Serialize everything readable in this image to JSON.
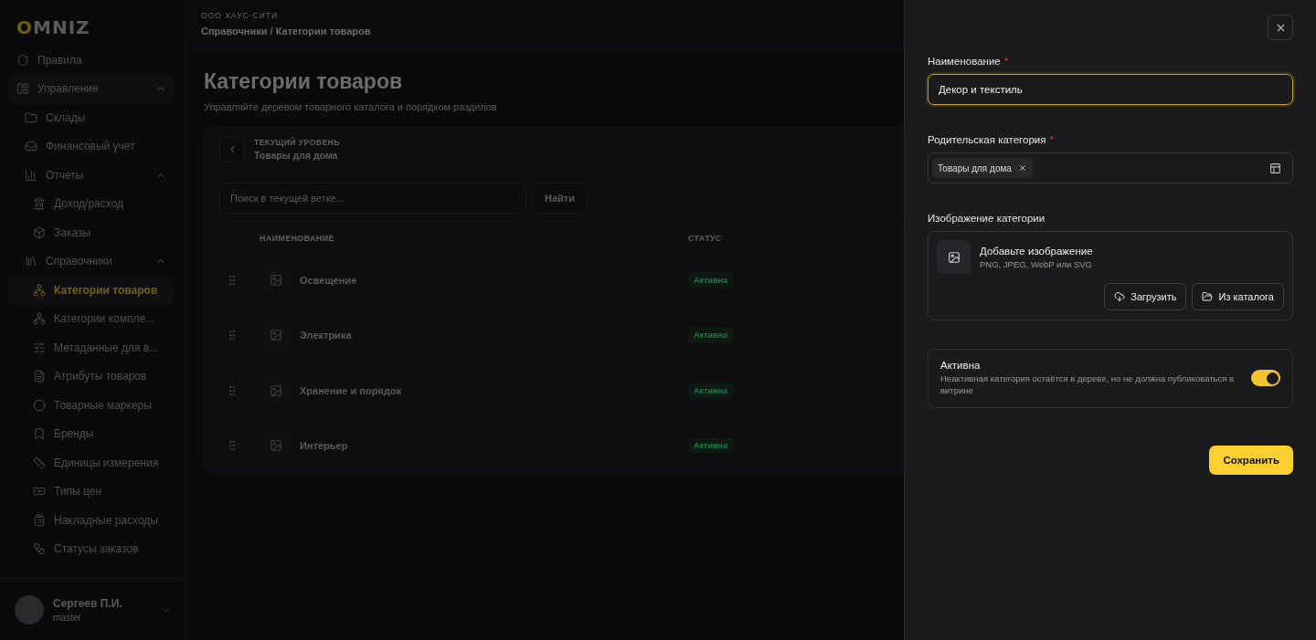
{
  "sidebar": {
    "logo": {
      "accent": "O",
      "rest": "MNIZ"
    },
    "items": [
      {
        "label": "Правила",
        "selected": false
      },
      {
        "label": "Управление",
        "selected": false,
        "expanded": true,
        "children": [
          {
            "label": "Склады",
            "selected": false
          },
          {
            "label": "Финансовый учет",
            "selected": false
          },
          {
            "label": "Отчеты",
            "selected": false,
            "expanded": true,
            "children": [
              {
                "label": "Доход/расход",
                "selected": false
              },
              {
                "label": "Заказы",
                "selected": false
              }
            ]
          },
          {
            "label": "Справочники",
            "selected": false,
            "expanded": true,
            "children": [
              {
                "label": "Категории товаров",
                "selected": true
              },
              {
                "label": "Категории компле...",
                "selected": false
              },
              {
                "label": "Метаданные для в...",
                "selected": false
              },
              {
                "label": "Атрибуты товаров",
                "selected": false
              },
              {
                "label": "Товарные маркеры",
                "selected": false
              },
              {
                "label": "Бренды",
                "selected": false
              },
              {
                "label": "Единицы измерения",
                "selected": false
              },
              {
                "label": "Типы цен",
                "selected": false
              },
              {
                "label": "Накладные расходы",
                "selected": false
              },
              {
                "label": "Статусы заказов",
                "selected": false
              }
            ]
          }
        ]
      }
    ],
    "user": {
      "name": "Сергеев П.И.",
      "role": "master"
    }
  },
  "header": {
    "organization": "ООО ХАУС-СИТИ",
    "breadcrumb": "Справочники / Категории товаров"
  },
  "page": {
    "title": "Категории товаров",
    "subtitle": "Управляйте деревом товарного каталога и порядком разделов"
  },
  "level": {
    "label": "ТЕКУЩИЙ УРОВЕНЬ",
    "value": "Товары для дома"
  },
  "search": {
    "placeholder": "Поиск в текущей ветке...",
    "button": "Найти"
  },
  "table": {
    "columns": [
      "НАИМЕНОВАНИЕ",
      "СТАТУС"
    ],
    "rows": [
      {
        "name": "Освещение",
        "status": "Активна",
        "color": "#1f7a48"
      },
      {
        "name": "Электрика",
        "status": "Активна",
        "color": "#1f7a48"
      },
      {
        "name": "Хранение и порядок",
        "status": "Активна",
        "color": "#1f7a48"
      },
      {
        "name": "Интерьер",
        "status": "Активна",
        "color": "#1f7a48"
      }
    ]
  },
  "drawer": {
    "name_field": {
      "label": "Наименование",
      "required_mark": "*",
      "value": "Декор и текстиль"
    },
    "parent_field": {
      "label": "Родительская категория",
      "required_mark": "*",
      "tags": [
        "Товары для дома"
      ]
    },
    "image": {
      "label": "Изображение категории",
      "title": "Добавьте изображение",
      "hint": "PNG, JPEG, WebP или SVG",
      "buttons": [
        "Загрузить",
        "Из каталога"
      ]
    },
    "active": {
      "title": "Активна",
      "description": "Неактивная категория остаётся в дереве, но не должна публиковаться в витрине",
      "on": true
    },
    "save": "Сохранить"
  }
}
